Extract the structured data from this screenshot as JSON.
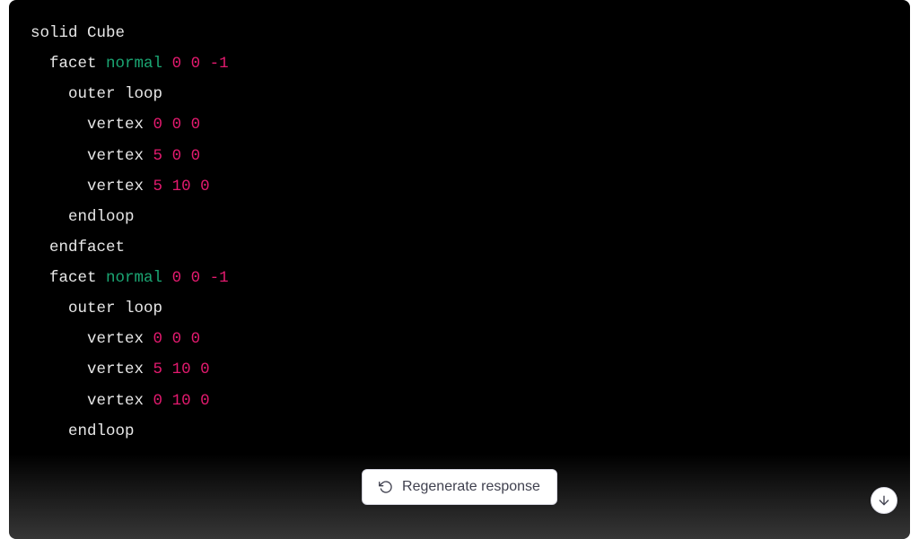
{
  "code": {
    "header": {
      "kw": "solid",
      "name": "Cube"
    },
    "facet_kw": "facet",
    "normal_kw": "normal",
    "outer_loop_kw": "outer loop",
    "vertex_kw": "vertex",
    "endloop_kw": "endloop",
    "endfacet_kw": "endfacet",
    "facets": [
      {
        "normal": [
          "0",
          "0",
          "-1"
        ],
        "vertices": [
          [
            "0",
            "0",
            "0"
          ],
          [
            "5",
            "0",
            "0"
          ],
          [
            "5",
            "10",
            "0"
          ]
        ]
      },
      {
        "normal": [
          "0",
          "0",
          "-1"
        ],
        "vertices": [
          [
            "0",
            "0",
            "0"
          ],
          [
            "5",
            "10",
            "0"
          ],
          [
            "0",
            "10",
            "0"
          ]
        ]
      }
    ]
  },
  "buttons": {
    "regenerate_label": "Regenerate response"
  }
}
